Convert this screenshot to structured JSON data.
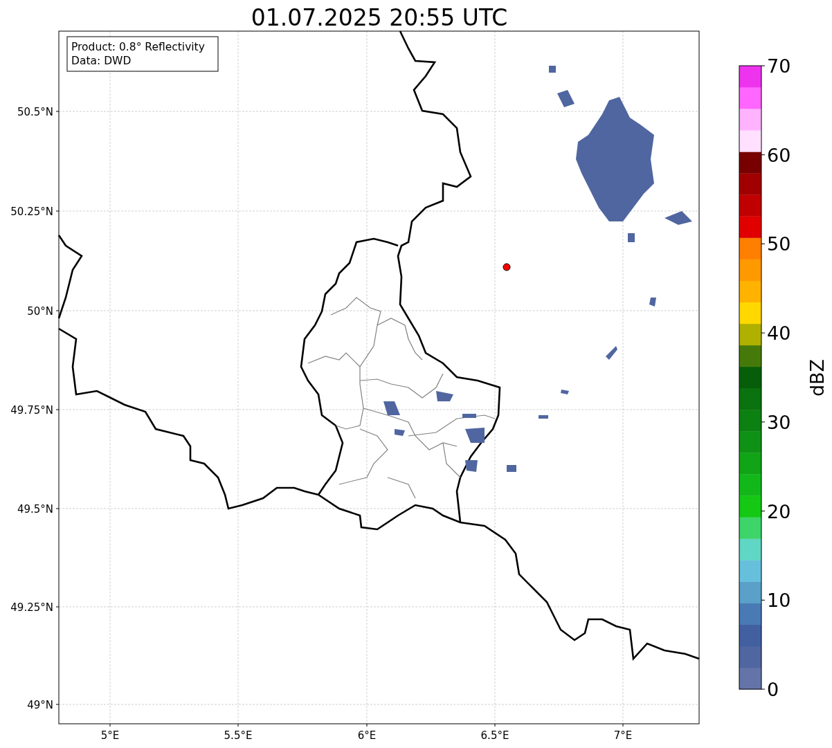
{
  "title": "01.07.2025 20:55 UTC",
  "info_box": [
    "Product: 0.8° Reflectivity",
    "Data: DWD"
  ],
  "y_axis_labels": [
    "50.5°N",
    "50.25°N",
    "50°N",
    "49.75°N",
    "49.5°N",
    "49.25°N",
    "49°N"
  ],
  "x_axis_labels": [
    "5°E",
    "5.5°E",
    "6°E",
    "6.5°E",
    "7°E"
  ],
  "colorbar": {
    "label": "dBZ",
    "ticks": [
      "70",
      "60",
      "50",
      "40",
      "30",
      "20",
      "10",
      "0"
    ],
    "bands": [
      {
        "color": "#6474a8"
      },
      {
        "color": "#5066a0"
      },
      {
        "color": "#4260a0"
      },
      {
        "color": "#4a7ab4"
      },
      {
        "color": "#5aa0c8"
      },
      {
        "color": "#66c0dc"
      },
      {
        "color": "#60d6c4"
      },
      {
        "color": "#3dd46a"
      },
      {
        "color": "#14c814"
      },
      {
        "color": "#12b81a"
      },
      {
        "color": "#10a416"
      },
      {
        "color": "#0f9116"
      },
      {
        "color": "#0d8012"
      },
      {
        "color": "#0a720f"
      },
      {
        "color": "#065e0a"
      },
      {
        "color": "#457a0a"
      },
      {
        "color": "#b0b000"
      },
      {
        "color": "#ffd800"
      },
      {
        "color": "#ffb300"
      },
      {
        "color": "#ff9900"
      },
      {
        "color": "#ff7f00"
      },
      {
        "color": "#e00000"
      },
      {
        "color": "#c00000"
      },
      {
        "color": "#a00000"
      },
      {
        "color": "#780000"
      },
      {
        "color": "#ffe0ff"
      },
      {
        "color": "#ffb3ff"
      },
      {
        "color": "#ff66ff"
      },
      {
        "color": "#ee33ee"
      }
    ]
  }
}
